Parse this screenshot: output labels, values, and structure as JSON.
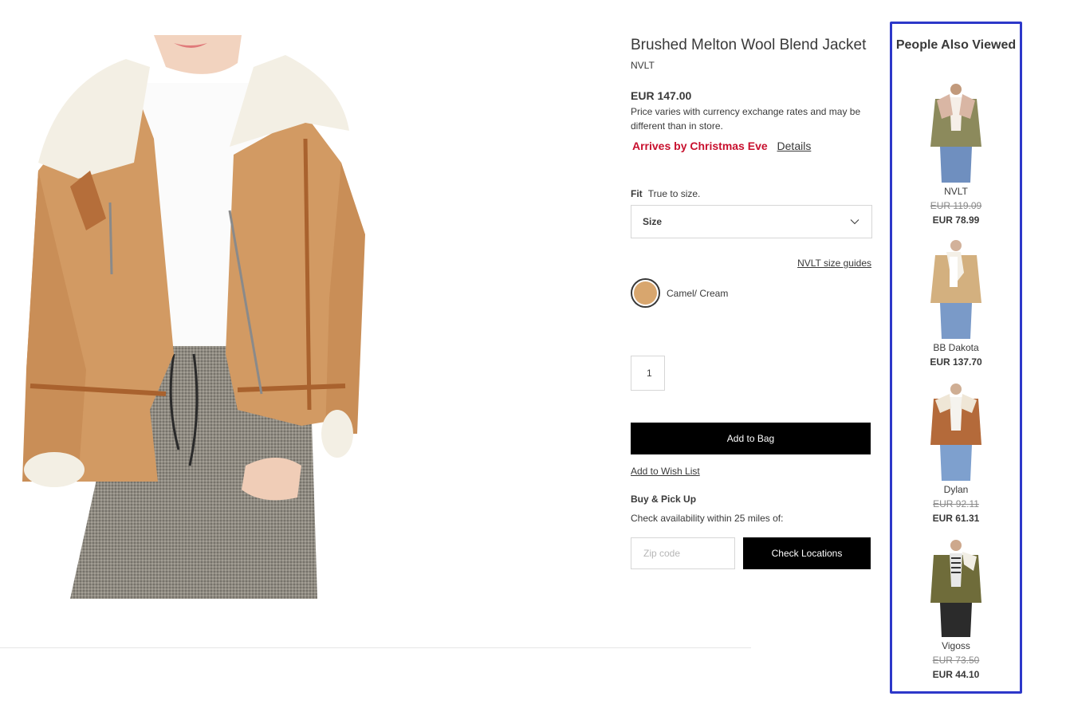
{
  "product": {
    "title": "Brushed Melton Wool Blend Jacket",
    "brand": "NVLT",
    "price": "EUR 147.00",
    "price_note": "Price varies with currency exchange rates and may be different than in store.",
    "arrives": "Arrives by Christmas Eve",
    "details_link": "Details",
    "fit_label": "Fit",
    "fit_value": "True to size.",
    "size_label": "Size",
    "size_guides": "NVLT size guides",
    "color_name": "Camel/ Cream",
    "quantity": "1",
    "add_to_bag": "Add to Bag",
    "add_to_wishlist": "Add to Wish List",
    "pickup_title": "Buy & Pick Up",
    "pickup_note": "Check availability within 25 miles of:",
    "zip_placeholder": "Zip code",
    "check_locations": "Check Locations"
  },
  "colors": {
    "arrives_red": "#c8102e",
    "swatch_camel": "#d8a66e",
    "highlight_border": "#2d38c9",
    "button_bg": "#000000"
  },
  "people_also_viewed": {
    "title": "People Also Viewed",
    "items": [
      {
        "brand": "NVLT",
        "original_price": "EUR 119.09",
        "price": "EUR 78.99"
      },
      {
        "brand": "BB Dakota",
        "original_price": "",
        "price": "EUR 137.70"
      },
      {
        "brand": "Dylan",
        "original_price": "EUR 92.11",
        "price": "EUR 61.31"
      },
      {
        "brand": "Vigoss",
        "original_price": "EUR 73.50",
        "price": "EUR 44.10"
      }
    ]
  }
}
